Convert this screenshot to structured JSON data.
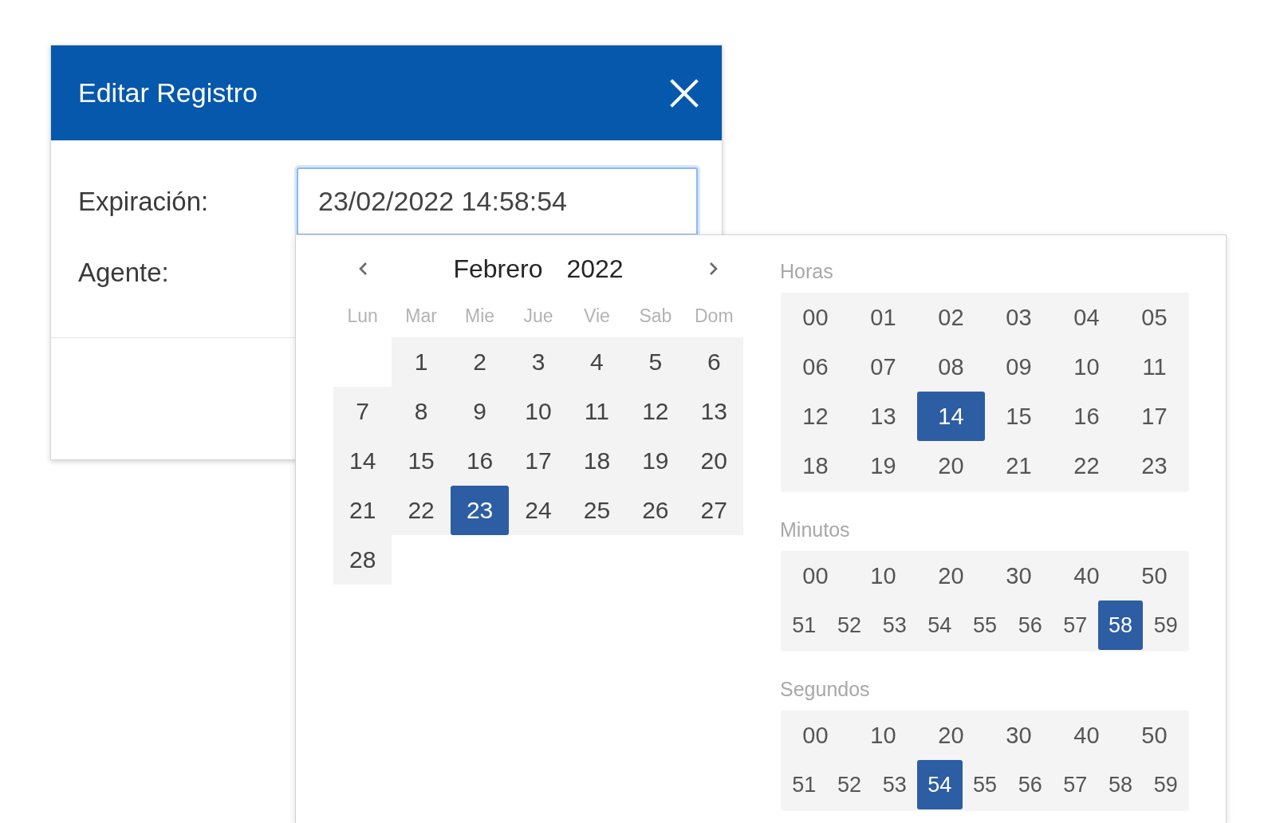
{
  "dialog": {
    "title": "Editar Registro",
    "fields": [
      {
        "label": "Expiración:",
        "value": "23/02/2022 14:58:54",
        "focused": true
      },
      {
        "label": "Agente:"
      }
    ]
  },
  "date_picker": {
    "calendar": {
      "month": "Febrero",
      "year": "2022",
      "weekdays": [
        "Lun",
        "Mar",
        "Mie",
        "Jue",
        "Vie",
        "Sab",
        "Dom"
      ],
      "weeks": [
        [
          {
            "label": "1",
            "selected": false
          },
          {
            "label": "2",
            "selected": false
          },
          {
            "label": "3",
            "selected": false
          },
          {
            "label": "4",
            "selected": false
          },
          {
            "label": "5",
            "selected": false
          },
          {
            "label": "6",
            "selected": false
          }
        ],
        [
          {
            "label": "7",
            "selected": false
          },
          {
            "label": "8",
            "selected": false
          },
          {
            "label": "9",
            "selected": false
          },
          {
            "label": "10",
            "selected": false
          },
          {
            "label": "11",
            "selected": false
          },
          {
            "label": "12",
            "selected": false
          },
          {
            "label": "13",
            "selected": false
          }
        ],
        [
          {
            "label": "14",
            "selected": false
          },
          {
            "label": "15",
            "selected": false
          },
          {
            "label": "16",
            "selected": false
          },
          {
            "label": "17",
            "selected": false
          },
          {
            "label": "18",
            "selected": false
          },
          {
            "label": "19",
            "selected": false
          },
          {
            "label": "20",
            "selected": false
          }
        ],
        [
          {
            "label": "21",
            "selected": false
          },
          {
            "label": "22",
            "selected": false
          },
          {
            "label": "23",
            "selected": true
          },
          {
            "label": "24",
            "selected": false
          },
          {
            "label": "25",
            "selected": false
          },
          {
            "label": "26",
            "selected": false
          },
          {
            "label": "27",
            "selected": false
          }
        ],
        [
          {
            "label": "28",
            "selected": false
          }
        ]
      ]
    },
    "time": [
      {
        "label": "Horas",
        "rows": [
          [
            {
              "label": "00",
              "selected": false
            },
            {
              "label": "01",
              "selected": false
            },
            {
              "label": "02",
              "selected": false
            },
            {
              "label": "03",
              "selected": false
            },
            {
              "label": "04",
              "selected": false
            },
            {
              "label": "05",
              "selected": false
            }
          ],
          [
            {
              "label": "06",
              "selected": false
            },
            {
              "label": "07",
              "selected": false
            },
            {
              "label": "08",
              "selected": false
            },
            {
              "label": "09",
              "selected": false
            },
            {
              "label": "10",
              "selected": false
            },
            {
              "label": "11",
              "selected": false
            }
          ],
          [
            {
              "label": "12",
              "selected": false
            },
            {
              "label": "13",
              "selected": false
            },
            {
              "label": "14",
              "selected": true
            },
            {
              "label": "15",
              "selected": false
            },
            {
              "label": "16",
              "selected": false
            },
            {
              "label": "17",
              "selected": false
            }
          ],
          [
            {
              "label": "18",
              "selected": false
            },
            {
              "label": "19",
              "selected": false
            },
            {
              "label": "20",
              "selected": false
            },
            {
              "label": "21",
              "selected": false
            },
            {
              "label": "22",
              "selected": false
            },
            {
              "label": "23",
              "selected": false
            }
          ]
        ]
      },
      {
        "label": "Minutos",
        "rows": [
          [
            {
              "label": "00",
              "selected": false
            },
            {
              "label": "10",
              "selected": false
            },
            {
              "label": "20",
              "selected": false
            },
            {
              "label": "30",
              "selected": false
            },
            {
              "label": "40",
              "selected": false
            },
            {
              "label": "50",
              "selected": false
            }
          ],
          [
            {
              "label": "51",
              "selected": false
            },
            {
              "label": "52",
              "selected": false
            },
            {
              "label": "53",
              "selected": false
            },
            {
              "label": "54",
              "selected": false
            },
            {
              "label": "55",
              "selected": false
            },
            {
              "label": "56",
              "selected": false
            },
            {
              "label": "57",
              "selected": false
            },
            {
              "label": "58",
              "selected": true
            },
            {
              "label": "59",
              "selected": false
            }
          ]
        ]
      },
      {
        "label": "Segundos",
        "rows": [
          [
            {
              "label": "00",
              "selected": false
            },
            {
              "label": "10",
              "selected": false
            },
            {
              "label": "20",
              "selected": false
            },
            {
              "label": "30",
              "selected": false
            },
            {
              "label": "40",
              "selected": false
            },
            {
              "label": "50",
              "selected": false
            }
          ],
          [
            {
              "label": "51",
              "selected": false
            },
            {
              "label": "52",
              "selected": false
            },
            {
              "label": "53",
              "selected": false
            },
            {
              "label": "54",
              "selected": true
            },
            {
              "label": "55",
              "selected": false
            },
            {
              "label": "56",
              "selected": false
            },
            {
              "label": "57",
              "selected": false
            },
            {
              "label": "58",
              "selected": false
            },
            {
              "label": "59",
              "selected": false
            }
          ]
        ]
      }
    ]
  }
}
